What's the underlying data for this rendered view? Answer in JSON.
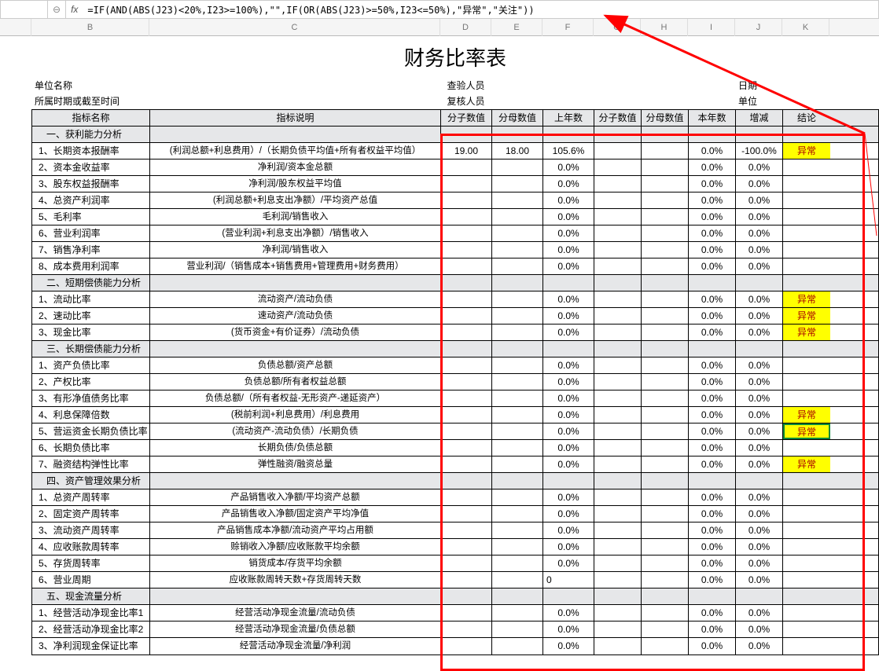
{
  "formula_bar": {
    "name_box": "",
    "formula": "=IF(AND(ABS(J23)<20%,I23>=100%),\"\",IF(OR(ABS(J23)>=50%,I23<=50%),\"异常\",\"关注\"))"
  },
  "col_headers": [
    "",
    "B",
    "C",
    "D",
    "E",
    "F",
    "G",
    "H",
    "I",
    "J",
    "K"
  ],
  "title": "财务比率表",
  "meta": {
    "b1": "单位名称",
    "d1": "查验人员",
    "j1": "日期",
    "b2": "所属时期或截至时间",
    "d2": "复核人员",
    "j2": "单位"
  },
  "headers": [
    "指标名称",
    "指标说明",
    "分子数值",
    "分母数值",
    "上年数",
    "分子数值",
    "分母数值",
    "本年数",
    "增减",
    "结论"
  ],
  "rows": [
    {
      "type": "section",
      "label": "一、获利能力分析"
    },
    {
      "type": "data",
      "name": "1、长期资本报酬率",
      "desc": "(利润总额+利息费用）/（长期负债平均值+所有者权益平均值）",
      "d": "19.00",
      "e": "18.00",
      "f": "105.6%",
      "i": "0.0%",
      "j": "-100.0%",
      "k": "异常",
      "warn": true
    },
    {
      "type": "data",
      "name": "2、资本金收益率",
      "desc": "净利润/资本金总额",
      "f": "0.0%",
      "i": "0.0%",
      "j": "0.0%"
    },
    {
      "type": "data",
      "name": "3、股东权益报酬率",
      "desc": "净利润/股东权益平均值",
      "f": "0.0%",
      "i": "0.0%",
      "j": "0.0%"
    },
    {
      "type": "data",
      "name": "4、总资产利润率",
      "desc": "(利润总额+利息支出净额）/平均资产总值",
      "f": "0.0%",
      "i": "0.0%",
      "j": "0.0%"
    },
    {
      "type": "data",
      "name": "5、毛利率",
      "desc": "毛利润/销售收入",
      "f": "0.0%",
      "i": "0.0%",
      "j": "0.0%"
    },
    {
      "type": "data",
      "name": "6、营业利润率",
      "desc": "(营业利润+利息支出净额）/销售收入",
      "f": "0.0%",
      "i": "0.0%",
      "j": "0.0%"
    },
    {
      "type": "data",
      "name": "7、销售净利率",
      "desc": "净利润/销售收入",
      "f": "0.0%",
      "i": "0.0%",
      "j": "0.0%"
    },
    {
      "type": "data",
      "name": "8、成本费用利润率",
      "desc": "营业利润/（销售成本+销售费用+管理费用+财务费用）",
      "f": "0.0%",
      "i": "0.0%",
      "j": "0.0%"
    },
    {
      "type": "section",
      "label": "二、短期偿债能力分析"
    },
    {
      "type": "data",
      "name": "1、流动比率",
      "desc": "流动资产/流动负债",
      "f": "0.0%",
      "i": "0.0%",
      "j": "0.0%",
      "k": "异常",
      "warn": true
    },
    {
      "type": "data",
      "name": "2、速动比率",
      "desc": "速动资产/流动负债",
      "f": "0.0%",
      "i": "0.0%",
      "j": "0.0%",
      "k": "异常",
      "warn": true
    },
    {
      "type": "data",
      "name": "3、现金比率",
      "desc": "(货币资金+有价证券）/流动负债",
      "f": "0.0%",
      "i": "0.0%",
      "j": "0.0%",
      "k": "异常",
      "warn": true
    },
    {
      "type": "section",
      "label": "三、长期偿债能力分析"
    },
    {
      "type": "data",
      "name": "1、资产负债比率",
      "desc": "负债总额/资产总额",
      "f": "0.0%",
      "i": "0.0%",
      "j": "0.0%"
    },
    {
      "type": "data",
      "name": "2、产权比率",
      "desc": "负债总额/所有者权益总额",
      "f": "0.0%",
      "i": "0.0%",
      "j": "0.0%"
    },
    {
      "type": "data",
      "name": "3、有形净值债务比率",
      "desc": "负债总额/（所有者权益-无形资产-递延资产）",
      "f": "0.0%",
      "i": "0.0%",
      "j": "0.0%"
    },
    {
      "type": "data",
      "name": "4、利息保障倍数",
      "desc": "(税前利润+利息费用）/利息费用",
      "f": "0.0%",
      "i": "0.0%",
      "j": "0.0%",
      "k": "异常",
      "warn": true
    },
    {
      "type": "data",
      "name": "5、营运资金长期负债比率",
      "desc": "(流动资产-流动负债）/长期负债",
      "f": "0.0%",
      "i": "0.0%",
      "j": "0.0%",
      "k": "异常",
      "warn": true,
      "selected": true
    },
    {
      "type": "data",
      "name": "6、长期负债比率",
      "desc": "长期负债/负债总额",
      "f": "0.0%",
      "i": "0.0%",
      "j": "0.0%"
    },
    {
      "type": "data",
      "name": "7、融资结构弹性比率",
      "desc": "弹性融资/融资总量",
      "f": "0.0%",
      "i": "0.0%",
      "j": "0.0%",
      "k": "异常",
      "warn": true
    },
    {
      "type": "section",
      "label": "四、资产管理效果分析"
    },
    {
      "type": "data",
      "name": "1、总资产周转率",
      "desc": "产品销售收入净额/平均资产总额",
      "f": "0.0%",
      "i": "0.0%",
      "j": "0.0%"
    },
    {
      "type": "data",
      "name": "2、固定资产周转率",
      "desc": "产品销售收入净额/固定资产平均净值",
      "f": "0.0%",
      "i": "0.0%",
      "j": "0.0%"
    },
    {
      "type": "data",
      "name": "3、流动资产周转率",
      "desc": "产品销售成本净额/流动资产平均占用额",
      "f": "0.0%",
      "i": "0.0%",
      "j": "0.0%"
    },
    {
      "type": "data",
      "name": "4、应收账款周转率",
      "desc": "赊销收入净额/应收账款平均余额",
      "f": "0.0%",
      "i": "0.0%",
      "j": "0.0%"
    },
    {
      "type": "data",
      "name": "5、存货周转率",
      "desc": "销货成本/存货平均余额",
      "f": "0.0%",
      "i": "0.0%",
      "j": "0.0%"
    },
    {
      "type": "data",
      "name": "6、营业周期",
      "desc": "应收账款周转天数+存货周转天数",
      "f": "0",
      "i": "0.0%",
      "j": "0.0%",
      "fLeft": true
    },
    {
      "type": "section",
      "label": "五、现金流量分析"
    },
    {
      "type": "data",
      "name": "1、经营活动净现金比率1",
      "desc": "经营活动净现金流量/流动负债",
      "f": "0.0%",
      "i": "0.0%",
      "j": "0.0%"
    },
    {
      "type": "data",
      "name": "2、经营活动净现金比率2",
      "desc": "经营活动净现金流量/负债总额",
      "f": "0.0%",
      "i": "0.0%",
      "j": "0.0%"
    },
    {
      "type": "data",
      "name": "3、净利润现金保证比率",
      "desc": "经营活动净现金流量/净利润",
      "f": "0.0%",
      "i": "0.0%",
      "j": "0.0%"
    }
  ]
}
